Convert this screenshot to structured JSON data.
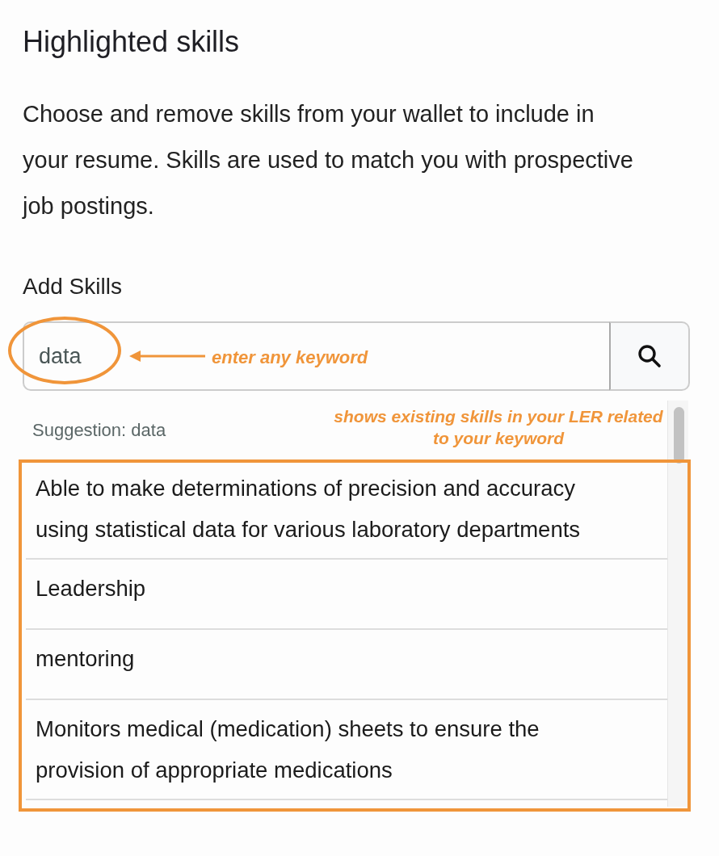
{
  "heading": "Highlighted skills",
  "description": "Choose and remove skills from your wallet to include in your resume. Skills are used to match you with prospective job postings.",
  "add_skills": {
    "label": "Add Skills",
    "search": {
      "value": "data"
    }
  },
  "annotations": [
    {
      "kind": "arrow",
      "text": "enter any keyword"
    },
    {
      "kind": "note",
      "text": "shows existing skills in your LER related to your keyword"
    }
  ],
  "suggestions": {
    "header": "Suggestion: data",
    "items": [
      {
        "text": "Able to make determinations of precision and accuracy using statistical data for various laboratory departments"
      },
      {
        "text": "Leadership"
      },
      {
        "text": "mentoring"
      },
      {
        "text": "Monitors medical (medication) sheets to ensure the provision of appropriate medications"
      }
    ]
  }
}
